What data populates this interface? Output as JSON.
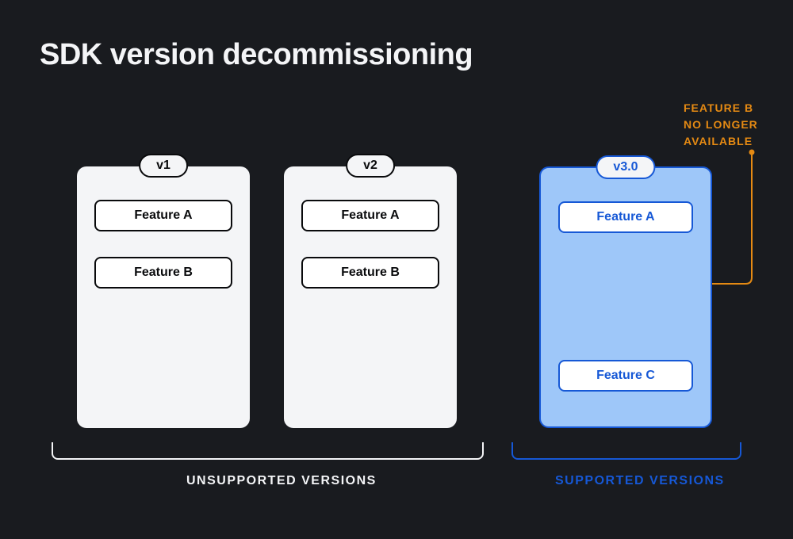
{
  "title": "SDK version decommissioning",
  "callout": "FEATURE B\nNO LONGER\nAVAILABLE",
  "cards": {
    "v1": {
      "version": "v1",
      "feature_a": "Feature A",
      "feature_b": "Feature B"
    },
    "v2": {
      "version": "v2",
      "feature_a": "Feature A",
      "feature_b": "Feature B"
    },
    "v3": {
      "version": "v3.0",
      "feature_a": "Feature A",
      "feature_c": "Feature C"
    }
  },
  "sections": {
    "unsupported": "UNSUPPORTED VERSIONS",
    "supported": "SUPPORTED VERSIONS"
  },
  "colors": {
    "bg": "#191b1f",
    "light": "#f4f5f7",
    "blue": "#1658d6",
    "blue_fill": "#9ec7f9",
    "orange": "#e58a13"
  }
}
